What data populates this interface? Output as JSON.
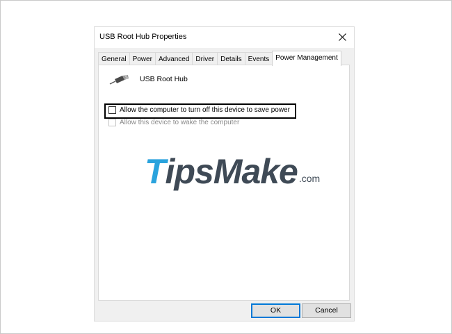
{
  "window": {
    "title": "USB Root Hub Properties"
  },
  "tabs": [
    {
      "label": "General"
    },
    {
      "label": "Power"
    },
    {
      "label": "Advanced"
    },
    {
      "label": "Driver"
    },
    {
      "label": "Details"
    },
    {
      "label": "Events"
    },
    {
      "label": "Power Management",
      "active": true
    }
  ],
  "device": {
    "name": "USB Root Hub",
    "icon": "usb-plug-icon"
  },
  "options": {
    "allow_turn_off": {
      "label": "Allow the computer to turn off this device to save power",
      "checked": false,
      "enabled": true
    },
    "allow_wake": {
      "label": "Allow this device to wake the computer",
      "checked": false,
      "enabled": false
    }
  },
  "watermark": {
    "brand_first": "T",
    "brand_rest": "ipsMake",
    "suffix": ".com"
  },
  "buttons": {
    "ok": "OK",
    "cancel": "Cancel"
  },
  "colors": {
    "dialog_bg": "#f0f0f0",
    "panel_bg": "#ffffff",
    "highlight_border": "#000000",
    "ok_border": "#0078d7",
    "watermark_blue": "#2aa3dd",
    "watermark_dark": "#3f4a56"
  }
}
